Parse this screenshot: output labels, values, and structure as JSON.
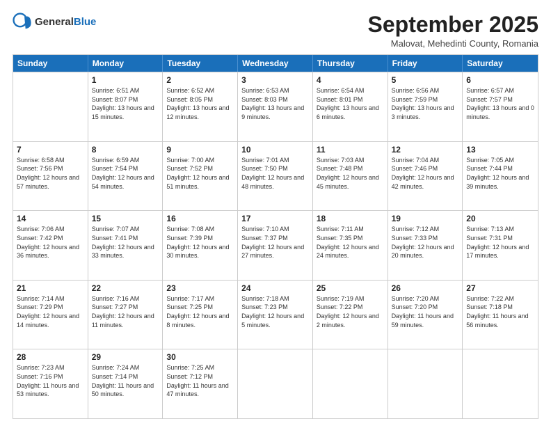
{
  "logo": {
    "general": "General",
    "blue": "Blue"
  },
  "header": {
    "month": "September 2025",
    "location": "Malovat, Mehedinti County, Romania"
  },
  "days": [
    "Sunday",
    "Monday",
    "Tuesday",
    "Wednesday",
    "Thursday",
    "Friday",
    "Saturday"
  ],
  "rows": [
    [
      {
        "day": "",
        "sunrise": "",
        "sunset": "",
        "daylight": ""
      },
      {
        "day": "1",
        "sunrise": "Sunrise: 6:51 AM",
        "sunset": "Sunset: 8:07 PM",
        "daylight": "Daylight: 13 hours and 15 minutes."
      },
      {
        "day": "2",
        "sunrise": "Sunrise: 6:52 AM",
        "sunset": "Sunset: 8:05 PM",
        "daylight": "Daylight: 13 hours and 12 minutes."
      },
      {
        "day": "3",
        "sunrise": "Sunrise: 6:53 AM",
        "sunset": "Sunset: 8:03 PM",
        "daylight": "Daylight: 13 hours and 9 minutes."
      },
      {
        "day": "4",
        "sunrise": "Sunrise: 6:54 AM",
        "sunset": "Sunset: 8:01 PM",
        "daylight": "Daylight: 13 hours and 6 minutes."
      },
      {
        "day": "5",
        "sunrise": "Sunrise: 6:56 AM",
        "sunset": "Sunset: 7:59 PM",
        "daylight": "Daylight: 13 hours and 3 minutes."
      },
      {
        "day": "6",
        "sunrise": "Sunrise: 6:57 AM",
        "sunset": "Sunset: 7:57 PM",
        "daylight": "Daylight: 13 hours and 0 minutes."
      }
    ],
    [
      {
        "day": "7",
        "sunrise": "Sunrise: 6:58 AM",
        "sunset": "Sunset: 7:56 PM",
        "daylight": "Daylight: 12 hours and 57 minutes."
      },
      {
        "day": "8",
        "sunrise": "Sunrise: 6:59 AM",
        "sunset": "Sunset: 7:54 PM",
        "daylight": "Daylight: 12 hours and 54 minutes."
      },
      {
        "day": "9",
        "sunrise": "Sunrise: 7:00 AM",
        "sunset": "Sunset: 7:52 PM",
        "daylight": "Daylight: 12 hours and 51 minutes."
      },
      {
        "day": "10",
        "sunrise": "Sunrise: 7:01 AM",
        "sunset": "Sunset: 7:50 PM",
        "daylight": "Daylight: 12 hours and 48 minutes."
      },
      {
        "day": "11",
        "sunrise": "Sunrise: 7:03 AM",
        "sunset": "Sunset: 7:48 PM",
        "daylight": "Daylight: 12 hours and 45 minutes."
      },
      {
        "day": "12",
        "sunrise": "Sunrise: 7:04 AM",
        "sunset": "Sunset: 7:46 PM",
        "daylight": "Daylight: 12 hours and 42 minutes."
      },
      {
        "day": "13",
        "sunrise": "Sunrise: 7:05 AM",
        "sunset": "Sunset: 7:44 PM",
        "daylight": "Daylight: 12 hours and 39 minutes."
      }
    ],
    [
      {
        "day": "14",
        "sunrise": "Sunrise: 7:06 AM",
        "sunset": "Sunset: 7:42 PM",
        "daylight": "Daylight: 12 hours and 36 minutes."
      },
      {
        "day": "15",
        "sunrise": "Sunrise: 7:07 AM",
        "sunset": "Sunset: 7:41 PM",
        "daylight": "Daylight: 12 hours and 33 minutes."
      },
      {
        "day": "16",
        "sunrise": "Sunrise: 7:08 AM",
        "sunset": "Sunset: 7:39 PM",
        "daylight": "Daylight: 12 hours and 30 minutes."
      },
      {
        "day": "17",
        "sunrise": "Sunrise: 7:10 AM",
        "sunset": "Sunset: 7:37 PM",
        "daylight": "Daylight: 12 hours and 27 minutes."
      },
      {
        "day": "18",
        "sunrise": "Sunrise: 7:11 AM",
        "sunset": "Sunset: 7:35 PM",
        "daylight": "Daylight: 12 hours and 24 minutes."
      },
      {
        "day": "19",
        "sunrise": "Sunrise: 7:12 AM",
        "sunset": "Sunset: 7:33 PM",
        "daylight": "Daylight: 12 hours and 20 minutes."
      },
      {
        "day": "20",
        "sunrise": "Sunrise: 7:13 AM",
        "sunset": "Sunset: 7:31 PM",
        "daylight": "Daylight: 12 hours and 17 minutes."
      }
    ],
    [
      {
        "day": "21",
        "sunrise": "Sunrise: 7:14 AM",
        "sunset": "Sunset: 7:29 PM",
        "daylight": "Daylight: 12 hours and 14 minutes."
      },
      {
        "day": "22",
        "sunrise": "Sunrise: 7:16 AM",
        "sunset": "Sunset: 7:27 PM",
        "daylight": "Daylight: 12 hours and 11 minutes."
      },
      {
        "day": "23",
        "sunrise": "Sunrise: 7:17 AM",
        "sunset": "Sunset: 7:25 PM",
        "daylight": "Daylight: 12 hours and 8 minutes."
      },
      {
        "day": "24",
        "sunrise": "Sunrise: 7:18 AM",
        "sunset": "Sunset: 7:23 PM",
        "daylight": "Daylight: 12 hours and 5 minutes."
      },
      {
        "day": "25",
        "sunrise": "Sunrise: 7:19 AM",
        "sunset": "Sunset: 7:22 PM",
        "daylight": "Daylight: 12 hours and 2 minutes."
      },
      {
        "day": "26",
        "sunrise": "Sunrise: 7:20 AM",
        "sunset": "Sunset: 7:20 PM",
        "daylight": "Daylight: 11 hours and 59 minutes."
      },
      {
        "day": "27",
        "sunrise": "Sunrise: 7:22 AM",
        "sunset": "Sunset: 7:18 PM",
        "daylight": "Daylight: 11 hours and 56 minutes."
      }
    ],
    [
      {
        "day": "28",
        "sunrise": "Sunrise: 7:23 AM",
        "sunset": "Sunset: 7:16 PM",
        "daylight": "Daylight: 11 hours and 53 minutes."
      },
      {
        "day": "29",
        "sunrise": "Sunrise: 7:24 AM",
        "sunset": "Sunset: 7:14 PM",
        "daylight": "Daylight: 11 hours and 50 minutes."
      },
      {
        "day": "30",
        "sunrise": "Sunrise: 7:25 AM",
        "sunset": "Sunset: 7:12 PM",
        "daylight": "Daylight: 11 hours and 47 minutes."
      },
      {
        "day": "",
        "sunrise": "",
        "sunset": "",
        "daylight": ""
      },
      {
        "day": "",
        "sunrise": "",
        "sunset": "",
        "daylight": ""
      },
      {
        "day": "",
        "sunrise": "",
        "sunset": "",
        "daylight": ""
      },
      {
        "day": "",
        "sunrise": "",
        "sunset": "",
        "daylight": ""
      }
    ]
  ]
}
